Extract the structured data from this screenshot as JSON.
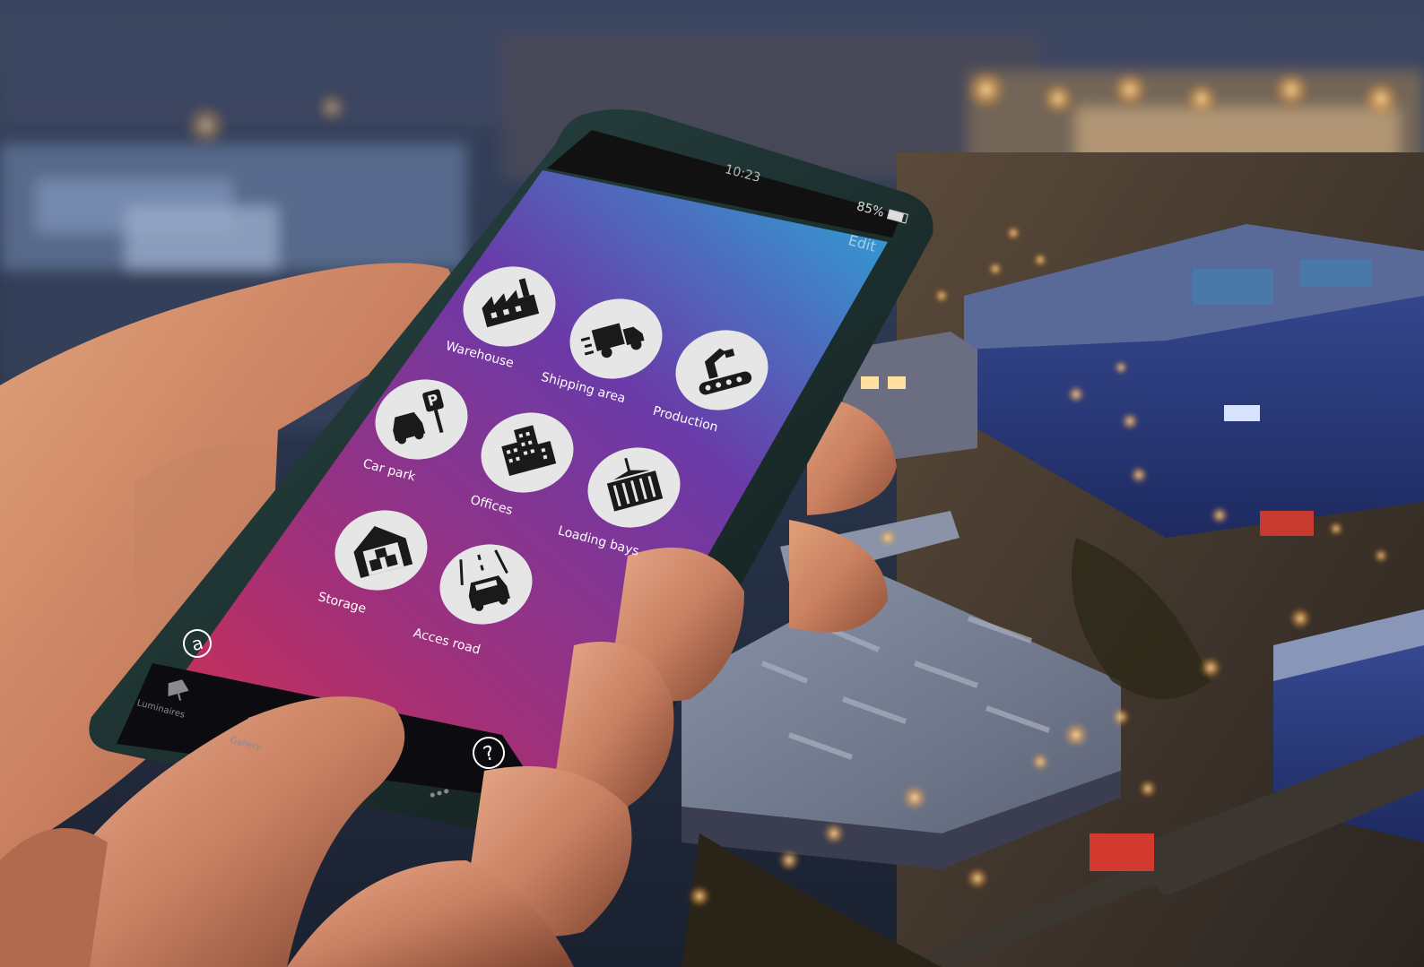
{
  "status_bar": {
    "time": "10:23",
    "battery": "85%"
  },
  "header": {
    "edit_label": "Edit"
  },
  "tiles": [
    {
      "label": "Warehouse",
      "icon": "factory-icon"
    },
    {
      "label": "Shipping area",
      "icon": "delivery-truck-icon"
    },
    {
      "label": "Production",
      "icon": "conveyor-robot-icon"
    },
    {
      "label": "Car park",
      "icon": "car-parking-icon"
    },
    {
      "label": "Offices",
      "icon": "office-building-icon"
    },
    {
      "label": "Loading bays",
      "icon": "container-crane-icon"
    },
    {
      "label": "Storage",
      "icon": "storage-warehouse-icon"
    },
    {
      "label": "Acces road",
      "icon": "car-road-icon"
    }
  ],
  "footer": {
    "brand_icon": "a-logo-icon",
    "help_icon": "help-icon"
  },
  "bottom_nav": [
    {
      "label": "Luminaires",
      "icon": "luminaire-icon"
    },
    {
      "label": "Gallery",
      "icon": "gallery-icon"
    },
    {
      "label": "More",
      "icon": "more-icon"
    }
  ],
  "colors": {
    "screen_gradient_top": "#2aa8d8",
    "screen_gradient_mid": "#6a3aa8",
    "screen_gradient_bottom": "#d8304a",
    "tile_circle": "#e6e6e6",
    "tile_icon": "#1a1a1a",
    "city_lights": "#ffc870",
    "building_blue": "#2a3a78"
  }
}
